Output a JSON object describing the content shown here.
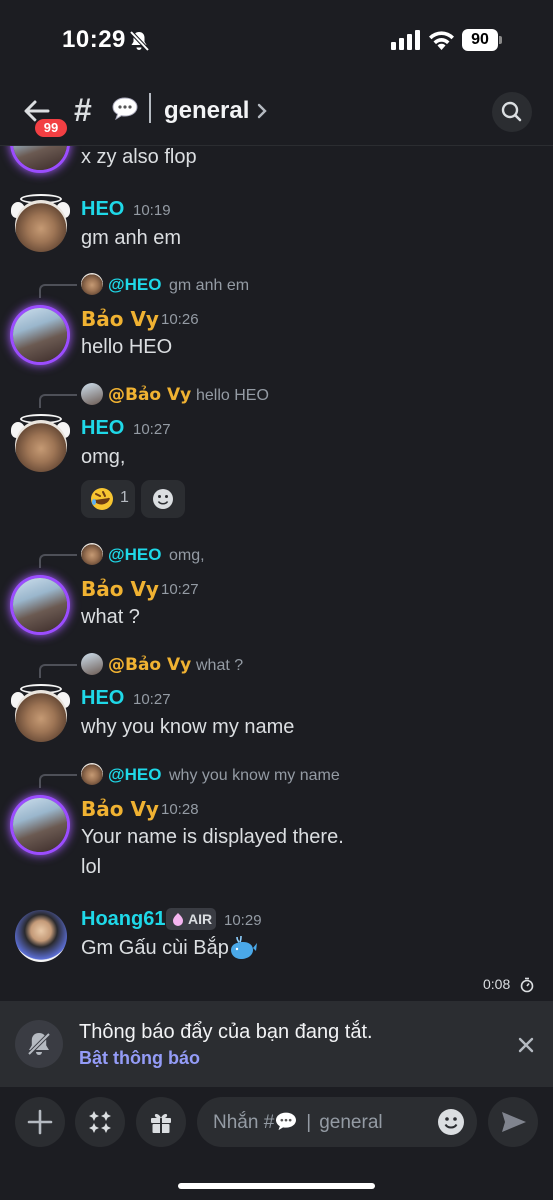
{
  "status_bar": {
    "time": "10:29",
    "battery": "90",
    "icons": [
      "bell-slash-icon",
      "signal-icon",
      "wifi-icon",
      "battery-icon"
    ]
  },
  "header": {
    "unread_badge": "99",
    "channel_prefix": "#",
    "channel_emoji": "speech-bubble",
    "channel_name": "general"
  },
  "messages": {
    "partial_text": "x zy also flop",
    "m1": {
      "author": "HEO",
      "time": "10:19",
      "text": "gm anh em"
    },
    "m2": {
      "reply_name": "@HEO",
      "reply_text": "gm anh em",
      "author": "Bảo Vy",
      "time": "10:26",
      "text": "hello HEO"
    },
    "m3": {
      "reply_name": "@Bảo Vy",
      "reply_text": "hello HEO",
      "author": "HEO",
      "time": "10:27",
      "text": "omg,",
      "reaction": {
        "emoji": "rolling-on-floor-laughing",
        "count": "1"
      }
    },
    "m4": {
      "reply_name": "@HEO",
      "reply_text": "omg,",
      "author": "Bảo Vy",
      "time": "10:27",
      "text": "what ?"
    },
    "m5": {
      "reply_name": "@Bảo Vy",
      "reply_text": "what ?",
      "author": "HEO",
      "time": "10:27",
      "text": "why you know my name"
    },
    "m6": {
      "reply_name": "@HEO",
      "reply_text": "why you know my name",
      "author": "Bảo Vy",
      "time": "10:28",
      "text_line1": "Your name is displayed there.",
      "text_line2": "lol"
    },
    "m7": {
      "author": "Hoang61",
      "tag": "AIR",
      "time": "10:29",
      "text": "Gm Gấu cùi Bắp"
    },
    "timer": "0:08"
  },
  "notification": {
    "title": "Thông báo đẩy của bạn đang tắt.",
    "link": "Bật thông báo"
  },
  "composer": {
    "placeholder_prefix": "Nhắn #",
    "placeholder_channel": "general"
  },
  "colors": {
    "background": "#1c1d22",
    "heo_name": "#1fd8e8",
    "vy_name": "#f0b232",
    "link": "#949cf7",
    "badge": "#f23f43"
  }
}
